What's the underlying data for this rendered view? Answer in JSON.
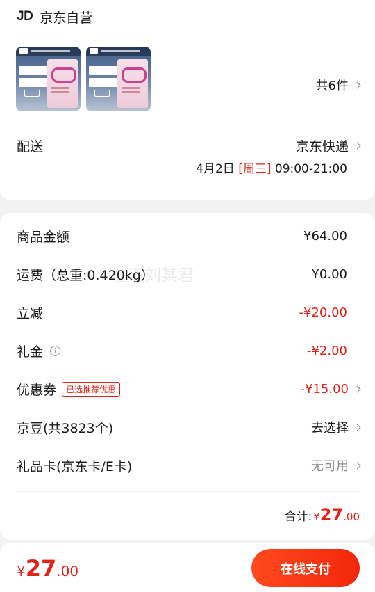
{
  "store": {
    "logo_text": "JD",
    "name": "京东自营"
  },
  "product": {
    "thumbnails": [
      {
        "name": "product-thumb-1"
      },
      {
        "name": "product-thumb-2"
      }
    ],
    "count_label": "共6件"
  },
  "delivery": {
    "label": "配送",
    "method": "京东快递",
    "date": "4月2日",
    "weekday": "[周三]",
    "time": "09:00-21:00"
  },
  "summary": {
    "rows": [
      {
        "label": "商品金额",
        "value": "¥64.00"
      },
      {
        "label": "运费（总重:0.420kg）",
        "value": "¥0.00"
      },
      {
        "label": "立减",
        "value": "-¥20.00"
      },
      {
        "label": "礼金",
        "value": "-¥2.00"
      },
      {
        "label": "优惠券",
        "tag": "已选推荐优惠",
        "value": "-¥15.00"
      },
      {
        "label": "京豆(共3823个)",
        "value": "去选择"
      },
      {
        "label": "礼品卡(京东卡/E卡)",
        "value": "无可用"
      }
    ],
    "total_label": "合计:",
    "total_symbol": "¥",
    "total_int": "27",
    "total_dec": ".00"
  },
  "watermark": "在下刘某君",
  "footer": {
    "price_symbol": "¥",
    "price_int": "27",
    "price_dec": ".00",
    "pay_button": "在线支付"
  },
  "colors": {
    "accent": "#e2231a",
    "button_start": "#ff4a1e",
    "button_end": "#f2270c"
  }
}
